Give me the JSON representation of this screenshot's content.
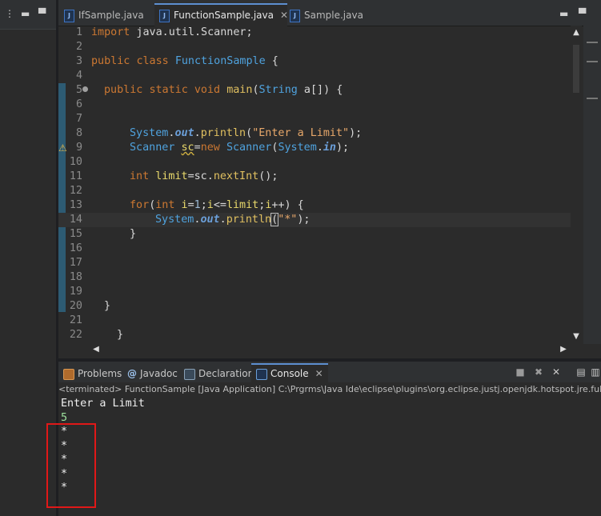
{
  "left_panel": {
    "icons": [
      "more-vertical-icon",
      "minimize-icon",
      "maximize-icon"
    ]
  },
  "editor": {
    "tabs": [
      {
        "label": "IfSample.java",
        "active": false
      },
      {
        "label": "FunctionSample.java",
        "active": true,
        "close": "✕"
      },
      {
        "label": "Sample.java",
        "active": false
      }
    ],
    "window_controls": [
      "minimize-icon",
      "maximize-icon"
    ],
    "code_lines": [
      {
        "n": "1"
      },
      {
        "n": "2"
      },
      {
        "n": "3"
      },
      {
        "n": "4"
      },
      {
        "n": "5"
      },
      {
        "n": "6"
      },
      {
        "n": "7"
      },
      {
        "n": "8"
      },
      {
        "n": "9"
      },
      {
        "n": "10"
      },
      {
        "n": "11"
      },
      {
        "n": "12"
      },
      {
        "n": "13"
      },
      {
        "n": "14"
      },
      {
        "n": "15"
      },
      {
        "n": "16"
      },
      {
        "n": "17"
      },
      {
        "n": "18"
      },
      {
        "n": "19"
      },
      {
        "n": "20"
      },
      {
        "n": "21"
      },
      {
        "n": "22"
      }
    ],
    "code": {
      "l1_kw": "import",
      "l1_rest": " java.util.Scanner;",
      "l3_kw1": "public",
      "l3_kw2": "class",
      "l3_name": "FunctionSample",
      "l3_rest": " {",
      "l5_kw1": "public",
      "l5_kw2": "static",
      "l5_kw3": "void",
      "l5_fn": "main",
      "l5_p1": "(",
      "l5_cls": "String",
      "l5_p2": " a[]) {",
      "l8_cls": "System",
      "l8_out": "out",
      "l8_fn": "println",
      "l8_str": "\"Enter a Limit\"",
      "l8_end": ");",
      "l9_cls": "Scanner",
      "l9_var": "sc",
      "l9_eq": "=",
      "l9_kw": "new",
      "l9_cls2": "Scanner",
      "l9_sys": "System",
      "l9_in": "in",
      "l9_end": ");",
      "l11_kw": "int",
      "l11_var": "limit",
      "l11_rest": "=sc.",
      "l11_fn": "nextInt",
      "l11_end": "();",
      "l13_kw": "for",
      "l13_kw2": "int",
      "l13_v1": "i",
      "l13_num": "1",
      "l13_v2": "i",
      "l13_v3": "limit",
      "l13_v4": "i",
      "l13_end": "++) {",
      "l14_cls": "System",
      "l14_out": "out",
      "l14_fn": "println",
      "l14_str": "\"*\"",
      "l14_end": ");",
      "l15": "}",
      "l20": "}",
      "l22": "}"
    }
  },
  "views": {
    "tabs": [
      {
        "label": "Problems",
        "icon": "problems-icon"
      },
      {
        "label": "Javadoc",
        "icon": "at-icon"
      },
      {
        "label": "Declaration",
        "icon": "declaration-icon"
      },
      {
        "label": "Console",
        "icon": "console-icon",
        "active": true,
        "close": "✕"
      }
    ],
    "console_header": "<terminated> FunctionSample [Java Application] C:\\Prgrms\\Java Ide\\eclipse\\plugins\\org.eclipse.justj.openjdk.hotspot.jre.full.wi",
    "console_lines": [
      "Enter a Limit",
      "5",
      "*",
      "*",
      "*",
      "*",
      "*"
    ]
  }
}
